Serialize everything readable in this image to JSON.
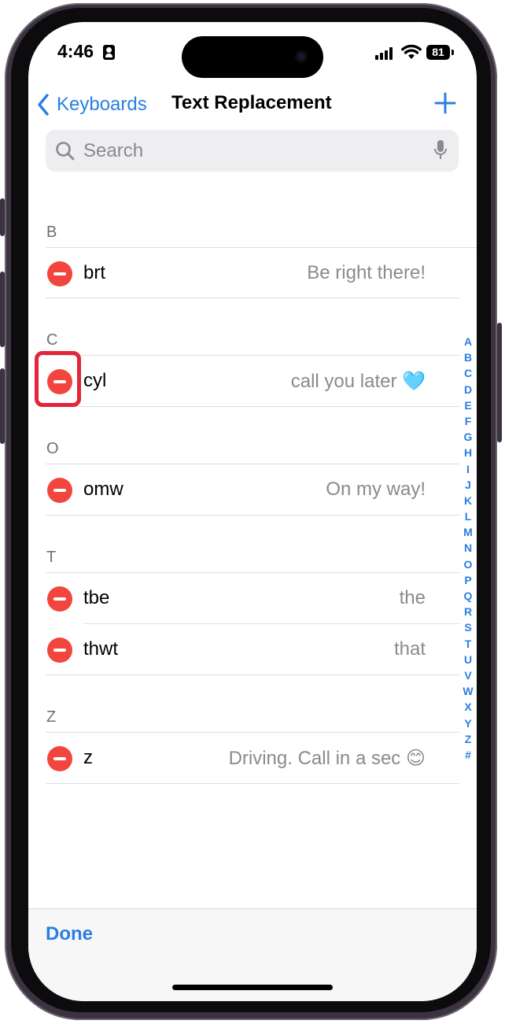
{
  "status_bar": {
    "time": "4:46",
    "battery": "81"
  },
  "nav": {
    "back_label": "Keyboards",
    "title": "Text Replacement"
  },
  "search": {
    "placeholder": "Search"
  },
  "sections": [
    {
      "letter": "B",
      "items": [
        {
          "shortcut": "brt",
          "phrase": "Be right there!"
        }
      ]
    },
    {
      "letter": "C",
      "items": [
        {
          "shortcut": "cyl",
          "phrase": "call you later 🩵"
        }
      ]
    },
    {
      "letter": "O",
      "items": [
        {
          "shortcut": "omw",
          "phrase": "On my way!"
        }
      ]
    },
    {
      "letter": "T",
      "items": [
        {
          "shortcut": "tbe",
          "phrase": "the"
        },
        {
          "shortcut": "thwt",
          "phrase": "that"
        }
      ]
    },
    {
      "letter": "Z",
      "items": [
        {
          "shortcut": "z",
          "phrase": "Driving. Call in a sec 😊"
        }
      ]
    }
  ],
  "index_letters": [
    "A",
    "B",
    "C",
    "D",
    "E",
    "F",
    "G",
    "H",
    "I",
    "J",
    "K",
    "L",
    "M",
    "N",
    "O",
    "P",
    "Q",
    "R",
    "S",
    "T",
    "U",
    "V",
    "W",
    "X",
    "Y",
    "Z",
    "#"
  ],
  "toolbar": {
    "done_label": "Done"
  },
  "colors": {
    "accent": "#2a7fe0",
    "delete": "#f2453d",
    "highlight": "#e5243a"
  }
}
